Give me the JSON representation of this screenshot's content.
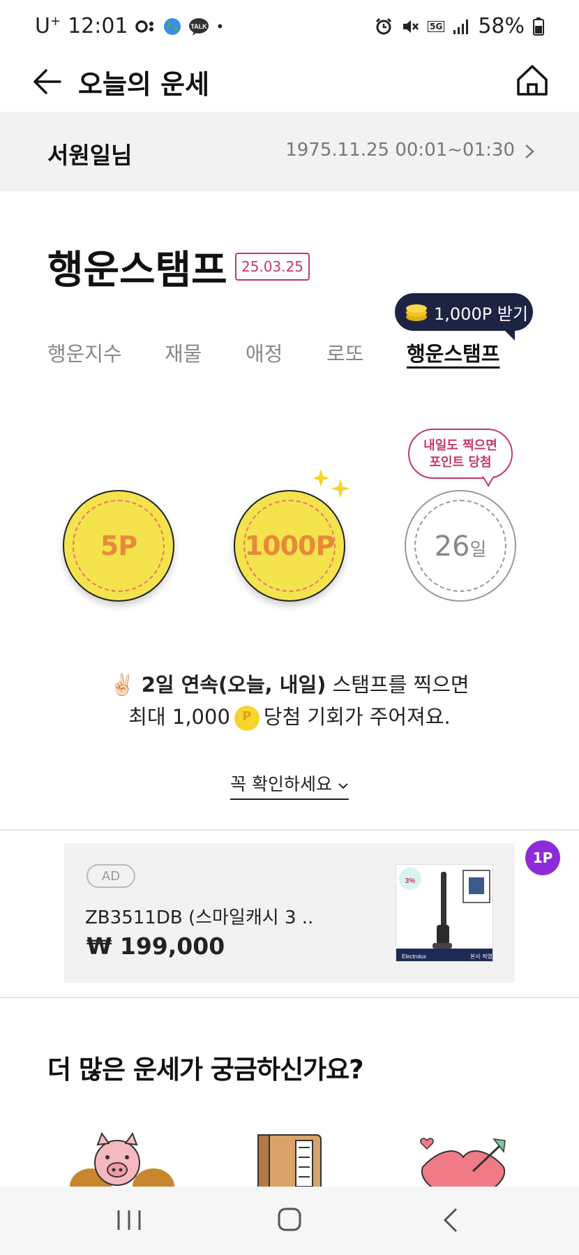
{
  "status_bar": {
    "carrier": "U",
    "carrier_sup": "+",
    "time": "12:01",
    "network": "5G",
    "battery": "58%"
  },
  "app_bar": {
    "title": "오늘의 운세"
  },
  "profile": {
    "name": "서원일님",
    "birth": "1975.11.25 00:01~01:30"
  },
  "section": {
    "title": "행운스탬프",
    "date": "25.03.25"
  },
  "tabs": [
    {
      "label": "행운지수",
      "active": false
    },
    {
      "label": "재물",
      "active": false
    },
    {
      "label": "애정",
      "active": false
    },
    {
      "label": "로또",
      "active": false
    },
    {
      "label": "행운스탬프",
      "active": true
    }
  ],
  "point_tooltip": {
    "label": "1,000P 받기"
  },
  "stamps": {
    "first": "5P",
    "second": "1000P",
    "third_number": "26",
    "third_unit": "일"
  },
  "bubble": {
    "line1": "내일도 찍으면",
    "line2": "포인트 당첨"
  },
  "info": {
    "emoji": "✌🏻",
    "bold": "2일 연속(오늘, 내일)",
    "line1_rest": " 스탬프를 찍으면",
    "line2_pre": "최대 1,000",
    "line2_post": "당첨 기회가 주어져요."
  },
  "check_link": {
    "label": "꼭 확인하세요"
  },
  "ad": {
    "badge": "AD",
    "title": "ZB3511DB (스마일캐시 3 ..",
    "price": "₩ 199,000",
    "point_badge": "1P",
    "image_brand": "Electrolux",
    "image_tag": "본사 직영",
    "image_promo": "3%"
  },
  "more": {
    "title": "더 많은 운세가 궁금하신가요?"
  },
  "colors": {
    "accent": "#c2386a",
    "coin_gold": "#f5e34e",
    "tooltip_navy": "#1d2343",
    "purple_badge": "#8d2bd8"
  }
}
